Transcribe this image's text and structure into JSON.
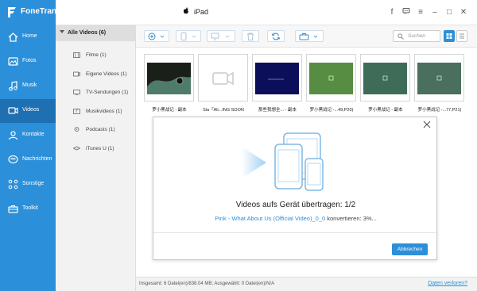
{
  "app": {
    "name": "FoneTrans",
    "device": "iPad"
  },
  "window_controls": [
    "facebook-icon",
    "message-icon",
    "menu-icon",
    "minimize-icon",
    "maximize-icon",
    "close-icon"
  ],
  "sidebar": {
    "items": [
      {
        "label": "Home",
        "icon": "home-icon"
      },
      {
        "label": "Fotos",
        "icon": "photo-icon"
      },
      {
        "label": "Musik",
        "icon": "music-icon"
      },
      {
        "label": "Videos",
        "icon": "video-icon",
        "active": true
      },
      {
        "label": "Kontakte",
        "icon": "contacts-icon"
      },
      {
        "label": "Nachrichten",
        "icon": "messages-icon"
      },
      {
        "label": "Sonstige",
        "icon": "other-icon"
      },
      {
        "label": "Toolkit",
        "icon": "toolkit-icon"
      }
    ]
  },
  "categories": {
    "header": "Alle Videos (6)",
    "items": [
      {
        "label": "Filme (1)",
        "icon": "film-icon"
      },
      {
        "label": "Eigene Videos (1)",
        "icon": "home-video-icon"
      },
      {
        "label": "TV-Sendungen (1)",
        "icon": "tv-icon"
      },
      {
        "label": "Musikvideos (1)",
        "icon": "music-video-icon"
      },
      {
        "label": "Podcasts (1)",
        "icon": "podcast-icon"
      },
      {
        "label": "iTunes U (1)",
        "icon": "itunes-u-icon"
      }
    ]
  },
  "toolbar": {
    "search_placeholder": "Suchen"
  },
  "thumbnails": [
    {
      "label": "罗小黑战记 - 副本"
    },
    {
      "label": "Sia『Ali...ING SOON"
    },
    {
      "label": "那些我想全... - 副本"
    },
    {
      "label": "罗小黑战记 -...49,P20)"
    },
    {
      "label": "罗小黑战记 - 副本"
    },
    {
      "label": "罗小黑战记 -...77,P21)"
    }
  ],
  "statusbar": {
    "text": "Insgesamt: 6 Datei(en)/838.04 MB; Ausgewählt: 0 Datei(en)/N/A",
    "link": "Daten verloren?"
  },
  "dialog": {
    "title": "Videos aufs Gerät übertragen: 1/2",
    "file": "Pink - What About Us (Official Video)_0_0",
    "status": " konvertieren: 3%...",
    "cancel_label": "Abbrechen"
  },
  "colors": {
    "accent": "#2c8fd9",
    "sidebar_active": "#1f6fb3"
  }
}
